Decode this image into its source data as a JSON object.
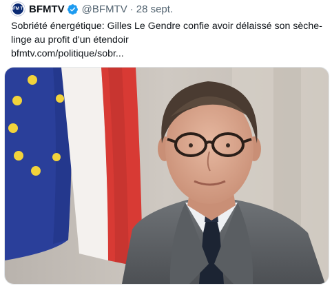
{
  "tweet": {
    "author_name": "BFMTV",
    "handle": "@BFMTV",
    "separator": "·",
    "date": "28 sept.",
    "avatar_text": "BFM TV",
    "text_line1": "Sobriété énergétique: Gilles Le Gendre confie avoir délaissé son sèche-",
    "text_line2": "linge au profit d'un étendoir",
    "link": "bfmtv.com/politique/sobr..."
  },
  "icons": {
    "verified": "verified-badge-icon"
  },
  "colors": {
    "verified_blue": "#1d9bf0",
    "text": "#0f1419",
    "muted": "#536471",
    "avatar_bg": "#0a2a73"
  }
}
